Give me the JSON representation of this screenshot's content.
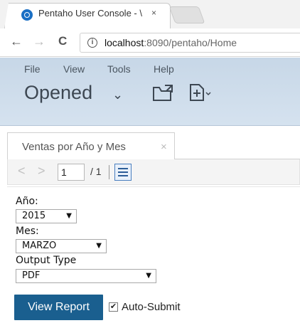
{
  "browser": {
    "tab_title": "Pentaho User Console - \\",
    "tab_close": "×",
    "nav": {
      "back": "←",
      "forward": "→",
      "reload": "C"
    },
    "info": "i",
    "url_host": "localhost",
    "url_rest": ":8090/pentaho/Home"
  },
  "header": {
    "menu": [
      "File",
      "View",
      "Tools",
      "Help"
    ],
    "perspective": "Opened",
    "chevron": "⌄",
    "brand_color": "#c7d7e7"
  },
  "report": {
    "tab_title": "Ventas por Año y Mes",
    "tab_close": "×",
    "pager": {
      "prev": "<",
      "next": ">",
      "page": "1",
      "total": "/ 1"
    }
  },
  "params": {
    "year_label": "Año:",
    "year_value": "2015",
    "month_label": "Mes:",
    "month_value": "MARZO",
    "output_label": "Output Type",
    "output_value": "PDF",
    "dropdown_arrow": "▼"
  },
  "actions": {
    "view_report": "View Report",
    "auto_submit_label": "Auto-Submit",
    "auto_submit_checked": "✔",
    "accent": "#1a5f8f"
  }
}
